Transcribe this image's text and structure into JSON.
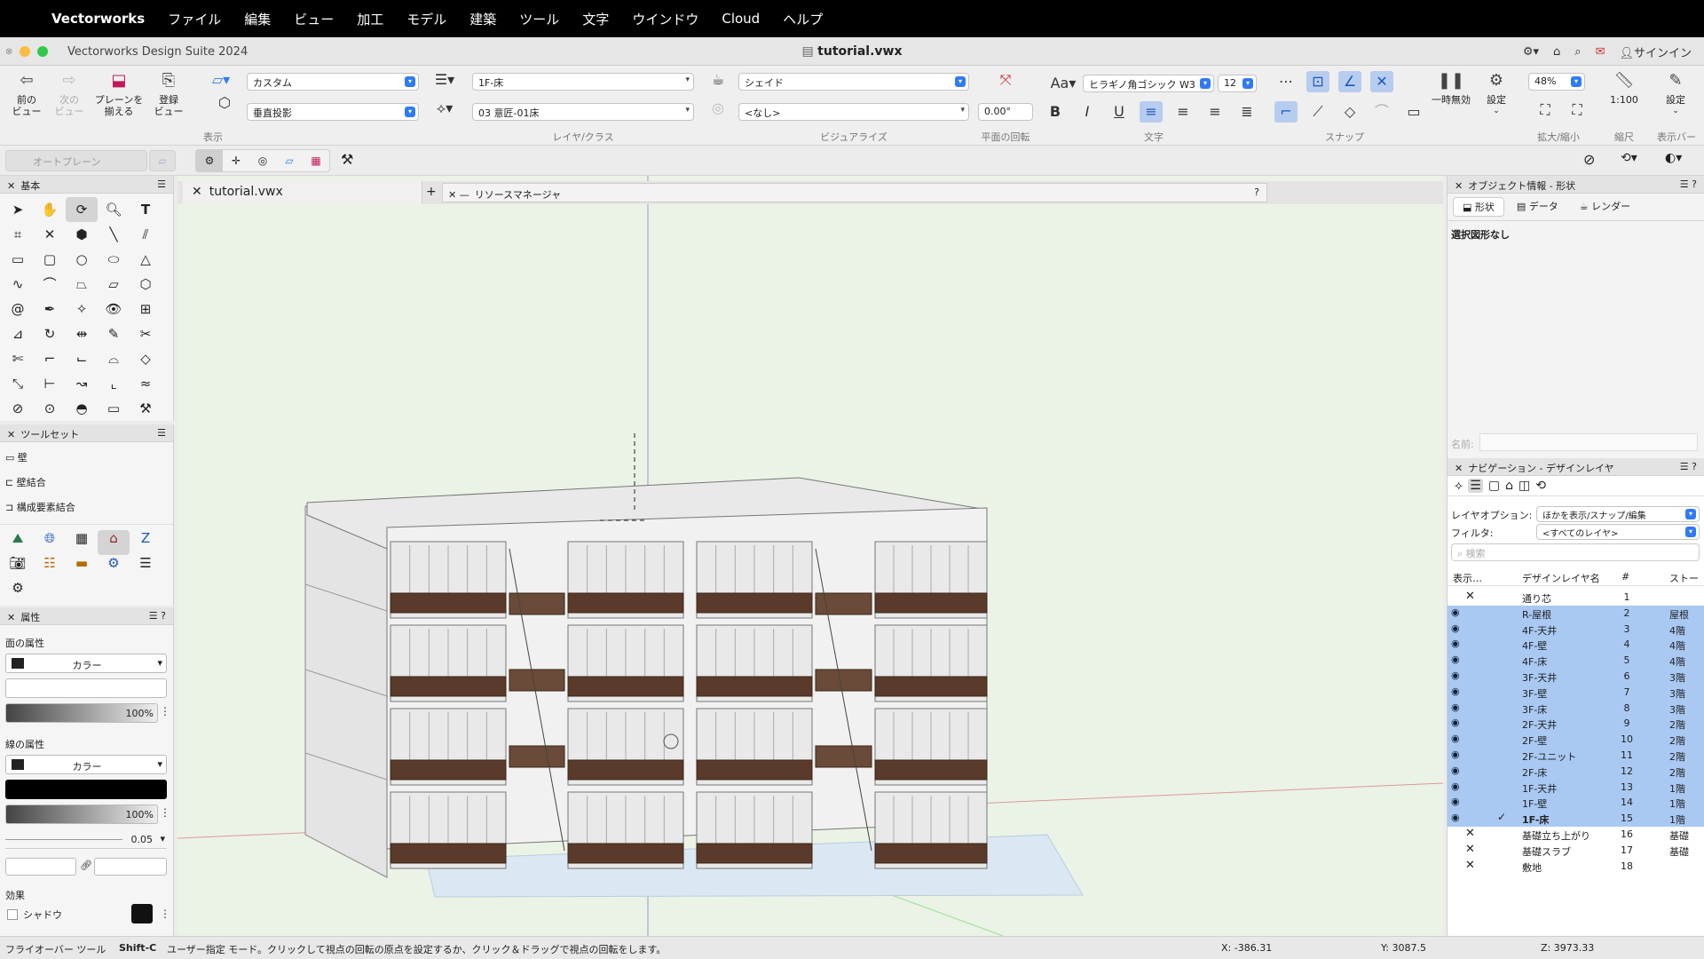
{
  "menubar": {
    "app_name": "Vectorworks",
    "items": [
      "ファイル",
      "編集",
      "ビュー",
      "加工",
      "モデル",
      "建築",
      "ツール",
      "文字",
      "ウインドウ",
      "Cloud",
      "ヘルプ"
    ]
  },
  "window": {
    "app_title": "Vectorworks Design Suite 2024",
    "doc_title": "tutorial.vwx",
    "signin_label": "サインイン"
  },
  "toolbar": {
    "prev_view": "前の\nビュー",
    "next_view": "次の\nビュー",
    "align_planes": "プレーンを\n揃える",
    "saved_view": "登録\nビュー",
    "group_display": "表示",
    "plane_select": "カスタム",
    "projection_select": "垂直投影",
    "layer_select": "1F-床",
    "class_select": "03 意匠-01床",
    "group_layer_class": "レイヤ/クラス",
    "render_select": "シェイド",
    "visualize_select": "<なし>",
    "group_visualize": "ビジュアライズ",
    "rotation_value": "0.00°",
    "group_rotation": "平面の回転",
    "font_select": "ヒラギノ角ゴシック W3",
    "font_size": "12",
    "group_text": "文字",
    "group_snap": "スナップ",
    "pause_label": "一時無効",
    "settings_label": "設定",
    "zoom_value": "48%",
    "group_zoom": "拡大/縮小",
    "scale_value": "1:100",
    "group_scale": "縮尺",
    "settings2_label": "設定",
    "group_displaybar": "表示バー",
    "autoplane_label": "オートプレーン"
  },
  "basic_panel": {
    "title": "基本"
  },
  "toolset_panel": {
    "title": "ツールセット",
    "items": [
      "壁",
      "壁結合",
      "構成要素結合"
    ]
  },
  "attributes_panel": {
    "title": "属性",
    "fill_label": "面の属性",
    "fill_type": "カラー",
    "fill_opacity": "100%",
    "line_label": "線の属性",
    "line_type": "カラー",
    "line_opacity": "100%",
    "line_weight": "0.05",
    "effects_label": "効果",
    "shadow_label": "シャドウ"
  },
  "doc_tabs": {
    "active_tab": "tutorial.vwx",
    "resource_manager": "リソースマネージャ"
  },
  "obj_info": {
    "title": "オブジェクト情報 - 形状",
    "tabs": [
      "形状",
      "データ",
      "レンダー"
    ],
    "no_selection": "選択図形なし",
    "name_label": "名前:"
  },
  "navigation": {
    "title": "ナビゲーション - デザインレイヤ",
    "layer_options_label": "レイヤオプション:",
    "layer_options_value": "ほかを表示/スナップ/編集",
    "filter_label": "フィルタ:",
    "filter_value": "<すべてのレイヤ>",
    "search_placeholder": "検索",
    "col_display": "表示…",
    "col_name": "デザインレイヤ名",
    "col_num": "#",
    "col_story": "ストー",
    "layers": [
      {
        "name": "通り芯",
        "num": "1",
        "story": "",
        "visible": false,
        "hl": false,
        "active": false
      },
      {
        "name": "R-屋根",
        "num": "2",
        "story": "屋根",
        "visible": true,
        "hl": true,
        "active": false
      },
      {
        "name": "4F-天井",
        "num": "3",
        "story": "4階",
        "visible": true,
        "hl": true,
        "active": false
      },
      {
        "name": "4F-壁",
        "num": "4",
        "story": "4階",
        "visible": true,
        "hl": true,
        "active": false
      },
      {
        "name": "4F-床",
        "num": "5",
        "story": "4階",
        "visible": true,
        "hl": true,
        "active": false
      },
      {
        "name": "3F-天井",
        "num": "6",
        "story": "3階",
        "visible": true,
        "hl": true,
        "active": false
      },
      {
        "name": "3F-壁",
        "num": "7",
        "story": "3階",
        "visible": true,
        "hl": true,
        "active": false
      },
      {
        "name": "3F-床",
        "num": "8",
        "story": "3階",
        "visible": true,
        "hl": true,
        "active": false
      },
      {
        "name": "2F-天井",
        "num": "9",
        "story": "2階",
        "visible": true,
        "hl": true,
        "active": false
      },
      {
        "name": "2F-壁",
        "num": "10",
        "story": "2階",
        "visible": true,
        "hl": true,
        "active": false
      },
      {
        "name": "2F-ユニット",
        "num": "11",
        "story": "2階",
        "visible": true,
        "hl": true,
        "active": false
      },
      {
        "name": "2F-床",
        "num": "12",
        "story": "2階",
        "visible": true,
        "hl": true,
        "active": false
      },
      {
        "name": "1F-天井",
        "num": "13",
        "story": "1階",
        "visible": true,
        "hl": true,
        "active": false
      },
      {
        "name": "1F-壁",
        "num": "14",
        "story": "1階",
        "visible": true,
        "hl": true,
        "active": false
      },
      {
        "name": "1F-床",
        "num": "15",
        "story": "1階",
        "visible": true,
        "hl": true,
        "active": true
      },
      {
        "name": "基礎立ち上がり",
        "num": "16",
        "story": "基礎",
        "visible": false,
        "hl": false,
        "active": false
      },
      {
        "name": "基礎スラブ",
        "num": "17",
        "story": "基礎",
        "visible": false,
        "hl": false,
        "active": false
      },
      {
        "name": "敷地",
        "num": "18",
        "story": "",
        "visible": false,
        "hl": false,
        "active": false
      }
    ]
  },
  "status": {
    "tool": "フライオーバー ツール",
    "shortcut": "Shift-C",
    "hint": "ユーザー指定 モード。クリックして視点の回転の原点を設定するか、クリック＆ドラッグで視点の回転をします。",
    "x": "X: -386.31",
    "y": "Y: 3087.5",
    "z": "Z: 3973.33"
  },
  "colors": {
    "accent": "#2f7bf5",
    "highlight": "#a9c9f3",
    "viewport": "#eaf3e6"
  }
}
